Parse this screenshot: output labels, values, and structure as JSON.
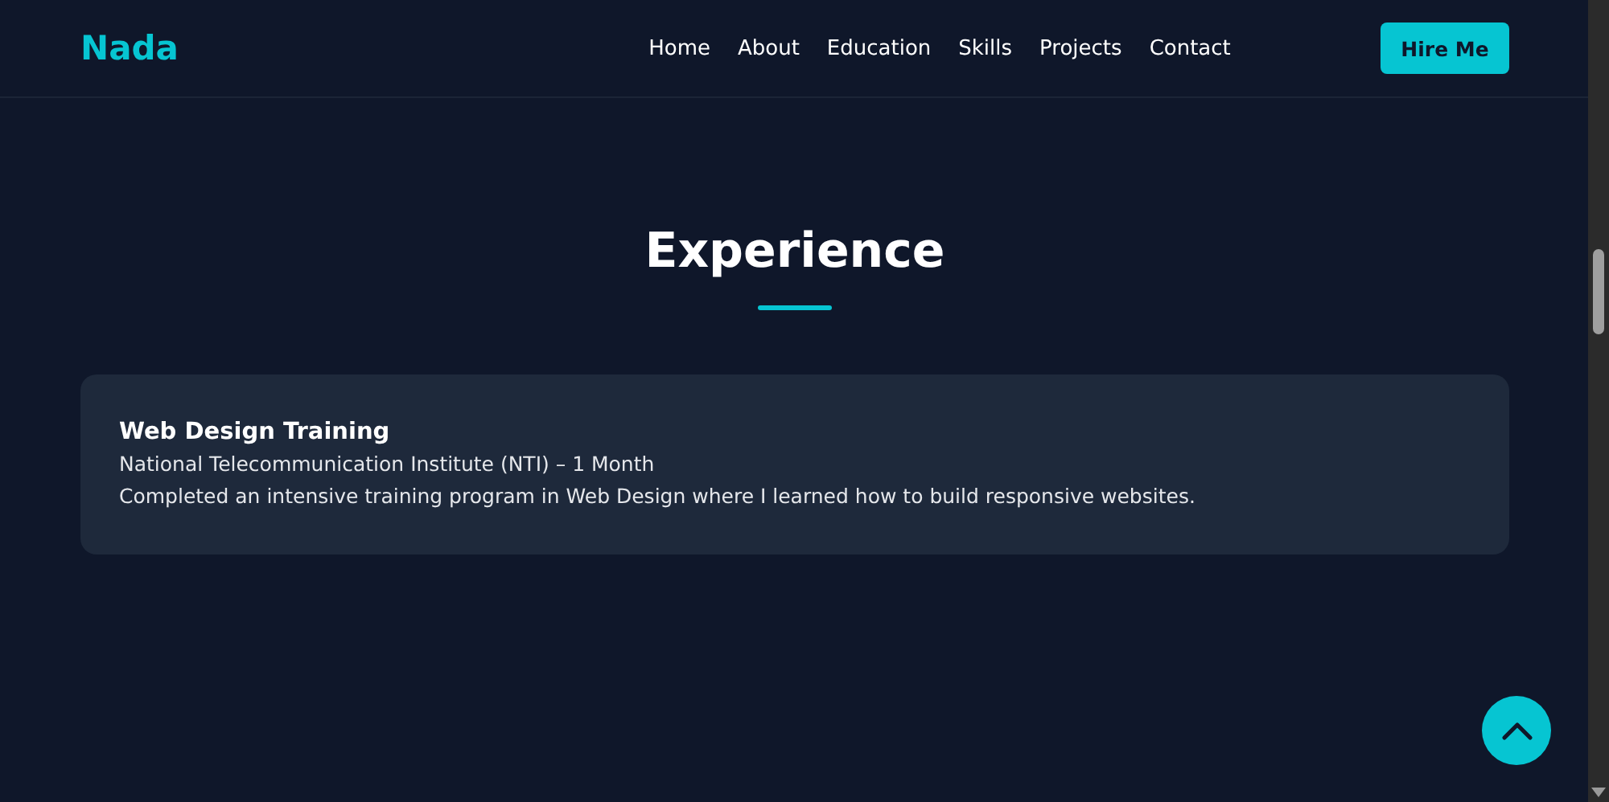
{
  "nav": {
    "logo": "Nada",
    "links": [
      "Home",
      "About",
      "Education",
      "Skills",
      "Projects",
      "Contact"
    ],
    "button": "Hire Me"
  },
  "section": {
    "title": "Experience"
  },
  "experience": [
    {
      "title": "Web Design Training",
      "subtitle": "National Telecommunication Institute (NTI) – 1 Month",
      "description": "Completed an intensive training program in Web Design where I learned how to build responsive websites."
    }
  ]
}
